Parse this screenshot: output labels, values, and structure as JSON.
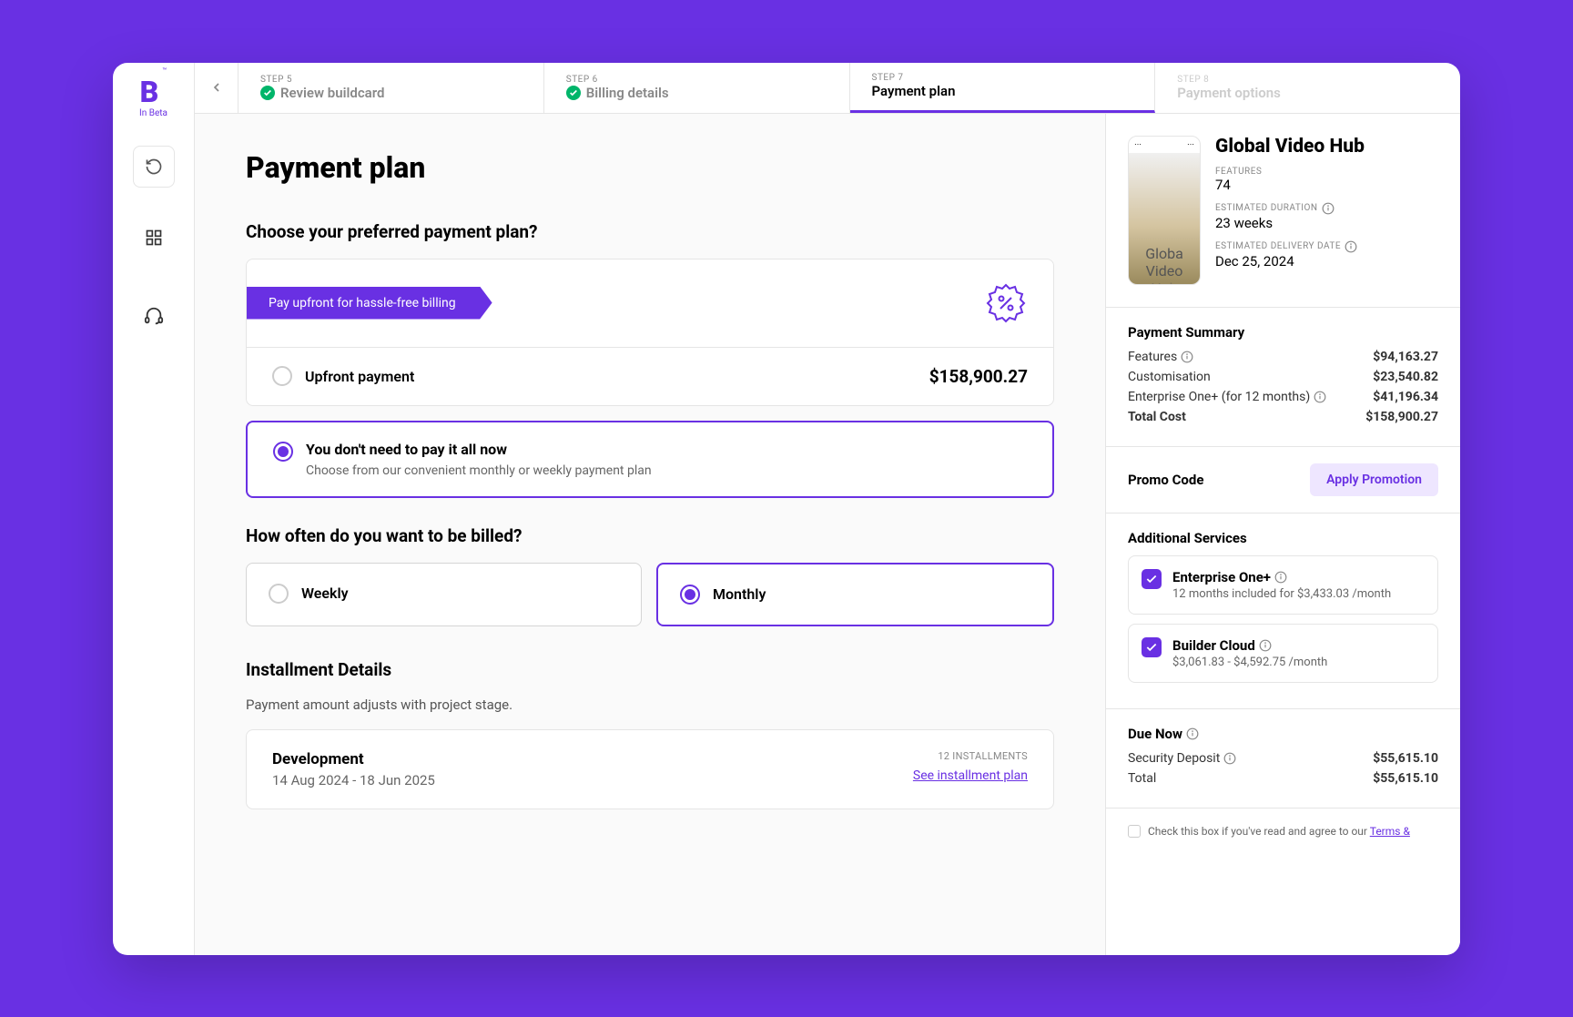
{
  "sidebar": {
    "logo_letter": "B",
    "logo_tm": "™",
    "logo_sub": "In Beta"
  },
  "steps": [
    {
      "num": "STEP 5",
      "title": "Review buildcard",
      "status": "done"
    },
    {
      "num": "STEP 6",
      "title": "Billing details",
      "status": "done"
    },
    {
      "num": "STEP 7",
      "title": "Payment plan",
      "status": "active"
    },
    {
      "num": "STEP 8",
      "title": "Payment options",
      "status": "disabled"
    }
  ],
  "page": {
    "title": "Payment plan",
    "choose_heading": "Choose your preferred payment plan?",
    "ribbon_text": "Pay upfront for hassle-free billing",
    "upfront_label": "Upfront payment",
    "upfront_price": "$158,900.27",
    "installment_option_title": "You don't need to pay it all now",
    "installment_option_sub": "Choose from our convenient monthly or weekly payment plan",
    "billing_heading": "How often do you want to be billed?",
    "billing_weekly": "Weekly",
    "billing_monthly": "Monthly",
    "details_heading": "Installment Details",
    "details_sub": "Payment amount adjusts with project stage.",
    "dev_title": "Development",
    "dev_dates": "14 Aug 2024 - 18 Jun 2025",
    "installments_count": "12 INSTALLMENTS",
    "installments_link": "See installment plan"
  },
  "summary": {
    "phone_line1": "Globa",
    "phone_line2": "Video",
    "title": "Global Video Hub",
    "features_label": "FEATURES",
    "features_value": "74",
    "duration_label": "ESTIMATED DURATION",
    "duration_value": "23 weeks",
    "delivery_label": "ESTIMATED DELIVERY DATE",
    "delivery_value": "Dec 25, 2024",
    "payment_summary_title": "Payment Summary",
    "lines": [
      {
        "label": "Features",
        "value": "$94,163.27"
      },
      {
        "label": "Customisation",
        "value": "$23,540.82"
      },
      {
        "label": "Enterprise One+ (for 12 months)",
        "value": "$41,196.34"
      },
      {
        "label": "Total Cost",
        "value": "$158,900.27"
      }
    ],
    "promo_label": "Promo Code",
    "promo_button": "Apply Promotion",
    "additional_title": "Additional Services",
    "services": [
      {
        "title": "Enterprise One+",
        "sub": "12 months included for $3,433.03 /month"
      },
      {
        "title": "Builder Cloud",
        "sub": "$3,061.83 - $4,592.75 /month"
      }
    ],
    "due_now_title": "Due Now",
    "due_lines": [
      {
        "label": "Security Deposit",
        "value": "$55,615.10"
      },
      {
        "label": "Total",
        "value": "$55,615.10"
      }
    ],
    "terms_text": "Check this box if you've read and agree to our ",
    "terms_link": "Terms &"
  }
}
